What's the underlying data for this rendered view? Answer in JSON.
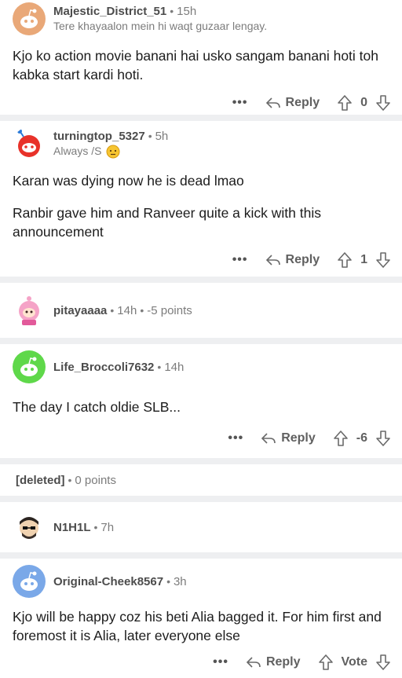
{
  "comments": [
    {
      "user": "Majestic_District_51",
      "time": "15h",
      "flair": "Tere khayaalon mein hi waqt guzaar lengay.",
      "body": [
        "Kjo ko action movie banani hai usko sangam banani hoti toh kabka start kardi hoti."
      ],
      "reply_label": "Reply",
      "score": "0",
      "avatar_color": "#e9a878"
    },
    {
      "user": "turningtop_5327",
      "time": "5h",
      "flair": "Always /S",
      "body": [
        "Karan was dying now he is dead lmao",
        "Ranbir gave him and Ranveer quite a kick with this announcement"
      ],
      "reply_label": "Reply",
      "score": "1",
      "avatar_color": "#e8322a"
    },
    {
      "user": "pitayaaaa",
      "time": "14h",
      "points": "-5 points",
      "collapsed": true,
      "avatar_color": "#f5a3c7"
    },
    {
      "user": "Life_Broccoli7632",
      "time": "14h",
      "body": [
        "The day I catch oldie SLB..."
      ],
      "reply_label": "Reply",
      "score": "-6",
      "avatar_color": "#5fd84a"
    },
    {
      "user": "[deleted]",
      "points": "0 points",
      "collapsed": true
    },
    {
      "user": "N1H1L",
      "time": "7h",
      "collapsed": true,
      "avatar_color": "#3a2f2a"
    },
    {
      "user": "Original-Cheek8567",
      "time": "3h",
      "body": [
        "Kjo will be happy coz his beti Alia bagged it. For him first and foremost it is Alia, later everyone else"
      ],
      "reply_label": "Reply",
      "score": "Vote",
      "avatar_color": "#7aa8e8"
    }
  ],
  "more_label": "•••",
  "separator": "•"
}
